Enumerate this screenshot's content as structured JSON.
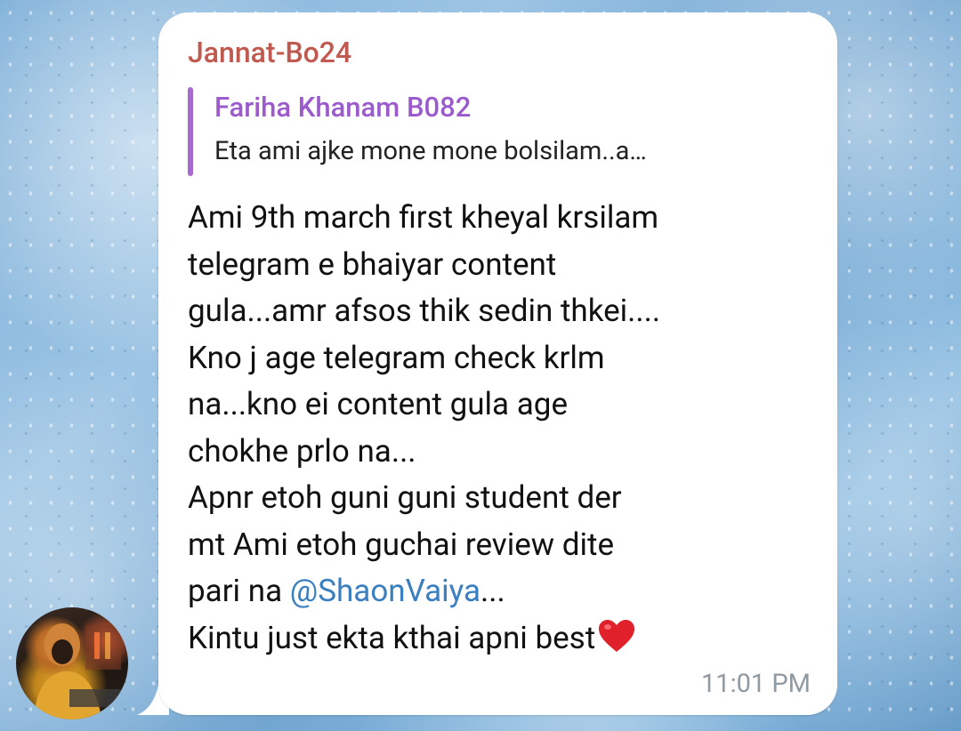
{
  "message": {
    "sender": "Jannat-Bo24",
    "reply": {
      "name": "Fariha Khanam B082",
      "text": "Eta ami ajke mone mone bolsilam..a…"
    },
    "lines": [
      "Ami 9th march first kheyal krsilam",
      "telegram e bhaiyar content",
      "gula...amr afsos thik sedin thkei....",
      "Kno j age telegram check krlm",
      "na...kno ei content gula age",
      "chokhe prlo na...",
      "Apnr etoh guni guni student der",
      "mt Ami etoh guchai review dite"
    ],
    "line9_prefix": "pari na ",
    "mention": "@ShaonVaiya",
    "line9_suffix": "...",
    "line10": "Kintu just ekta kthai apni best",
    "time": "11:01 PM"
  },
  "colors": {
    "sender": "#c0594f",
    "reply_accent": "#9b5bcc",
    "mention": "#3a7fc0",
    "heart": "#e0202a"
  },
  "icons": {
    "heart": "red-heart-emoji",
    "avatar": "user-avatar-photo"
  }
}
